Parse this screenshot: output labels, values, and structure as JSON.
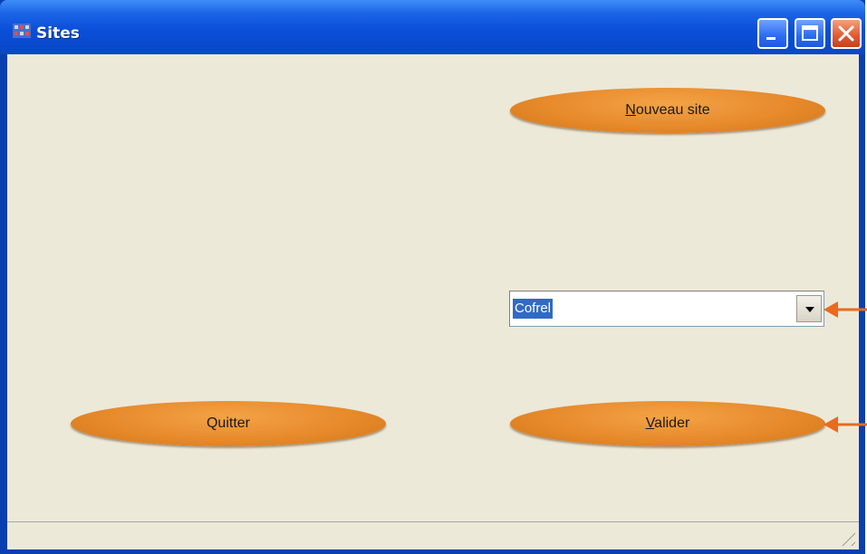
{
  "window": {
    "title": "Sites"
  },
  "titlebar": {
    "minimize_icon": "minimize-icon",
    "maximize_icon": "maximize-icon",
    "close_icon": "close-icon"
  },
  "buttons": {
    "new_site": {
      "mnemonic": "N",
      "rest": "ouveau site"
    },
    "quit": {
      "label": "Quitter"
    },
    "validate": {
      "mnemonic": "V",
      "rest": "alider"
    }
  },
  "combo": {
    "value": "Cofrel"
  },
  "colors": {
    "titlebar": "#0a4fd8",
    "button": "#e78a2c",
    "selection": "#316ac5",
    "arrow": "#ea6a1e"
  }
}
